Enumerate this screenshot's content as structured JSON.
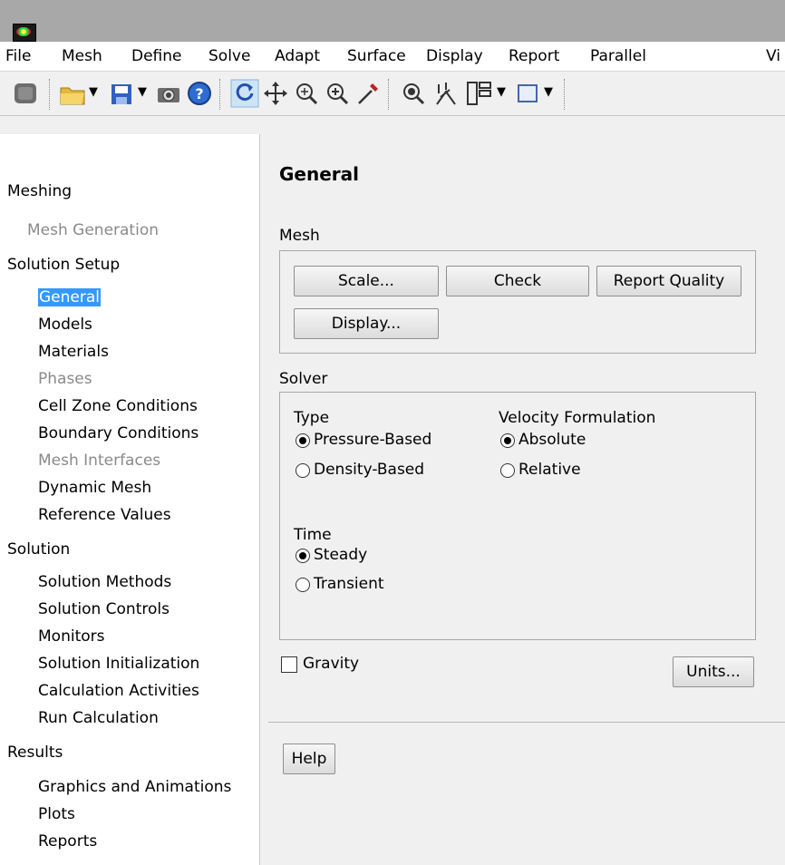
{
  "menu": [
    "File",
    "Mesh",
    "Define",
    "Solve",
    "Adapt",
    "Surface",
    "Display",
    "Report",
    "Parallel",
    "Vi"
  ],
  "toolbar_icons": [
    "record-icon",
    "open-folder-icon",
    "save-icon",
    "camera-icon",
    "help-icon",
    "rotate-icon",
    "pan-icon",
    "zoom-in-icon",
    "zoom-plus-icon",
    "probe-icon",
    "fit-view-icon",
    "mesh-lines-icon",
    "layout-icon",
    "window-icon"
  ],
  "tree": {
    "meshing": "Meshing",
    "mesh_generation": "Mesh Generation",
    "solution_setup": "Solution Setup",
    "general": "General",
    "models": "Models",
    "materials": "Materials",
    "phases": "Phases",
    "cell_zone": "Cell Zone Conditions",
    "boundary": "Boundary Conditions",
    "mesh_interfaces": "Mesh Interfaces",
    "dynamic_mesh": "Dynamic Mesh",
    "reference_values": "Reference Values",
    "solution": "Solution",
    "solution_methods": "Solution Methods",
    "solution_controls": "Solution Controls",
    "monitors": "Monitors",
    "solution_init": "Solution Initialization",
    "calc_activities": "Calculation Activities",
    "run_calc": "Run Calculation",
    "results": "Results",
    "graphics": "Graphics and Animations",
    "plots": "Plots",
    "reports": "Reports"
  },
  "panel": {
    "title": "General",
    "mesh_label": "Mesh",
    "scale": "Scale...",
    "check": "Check",
    "report_quality": "Report Quality",
    "display": "Display...",
    "solver_label": "Solver",
    "type_label": "Type",
    "pressure_based": "Pressure-Based",
    "density_based": "Density-Based",
    "velocity_label": "Velocity Formulation",
    "absolute": "Absolute",
    "relative": "Relative",
    "time_label": "Time",
    "steady": "Steady",
    "transient": "Transient",
    "gravity": "Gravity",
    "units": "Units...",
    "help": "Help"
  },
  "state": {
    "solver_type": "Pressure-Based",
    "velocity_formulation": "Absolute",
    "time": "Steady",
    "gravity": false
  },
  "colors": {
    "selection": "#3399ff",
    "disabled_text": "#8a8a8a"
  }
}
